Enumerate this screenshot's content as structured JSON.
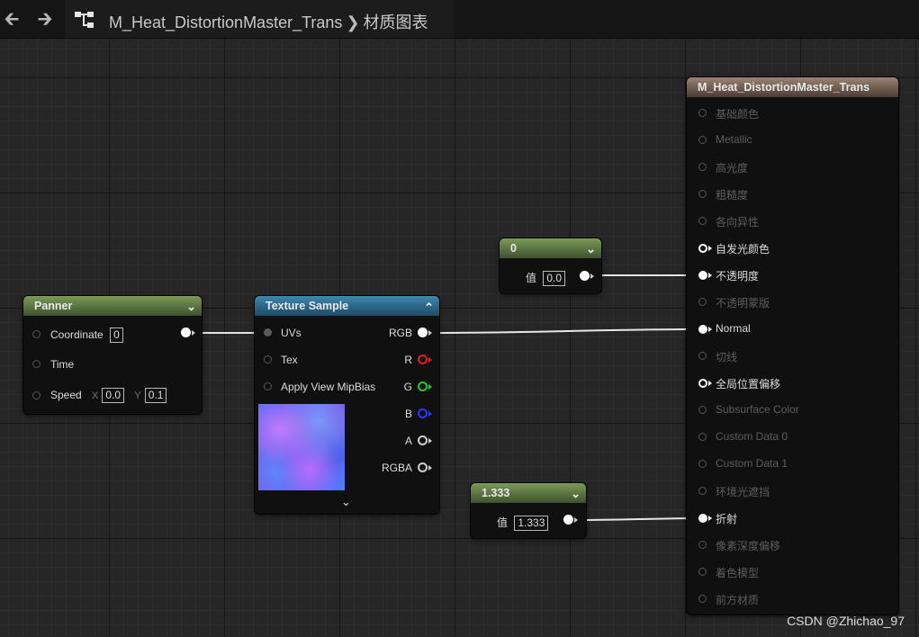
{
  "breadcrumb": {
    "asset": "M_Heat_DistortionMaster_Trans",
    "section": "材质图表"
  },
  "nodes": {
    "panner": {
      "title": "Panner",
      "coordinate_label": "Coordinate",
      "coordinate_value": "0",
      "time_label": "Time",
      "speed_label": "Speed",
      "speed_x_label": "X",
      "speed_x": "0.0",
      "speed_y_label": "Y",
      "speed_y": "0.1"
    },
    "texture_sample": {
      "title": "Texture Sample",
      "inputs": [
        "UVs",
        "Tex",
        "Apply View MipBias"
      ],
      "outputs": [
        "RGB",
        "R",
        "G",
        "B",
        "A",
        "RGBA"
      ]
    },
    "const_zero": {
      "title": "0",
      "value_label": "值",
      "value": "0.0"
    },
    "const_ior": {
      "title": "1.333",
      "value_label": "值",
      "value": "1.333"
    },
    "material_output": {
      "title": "M_Heat_DistortionMaster_Trans",
      "pins": [
        "基础颜色",
        "Metallic",
        "高光度",
        "粗糙度",
        "各向异性",
        "自发光颜色",
        "不透明度",
        "不透明蒙版",
        "Normal",
        "切线",
        "全局位置偏移",
        "Subsurface Color",
        "Custom Data 0",
        "Custom Data 1",
        "环境光遮挡",
        "折射",
        "像素深度偏移",
        "着色模型",
        "前方材质"
      ]
    }
  },
  "colors": {
    "pin_r": "#e02020",
    "pin_g": "#20d020",
    "pin_b": "#2a3cff"
  },
  "watermark": "CSDN @Zhichao_97"
}
